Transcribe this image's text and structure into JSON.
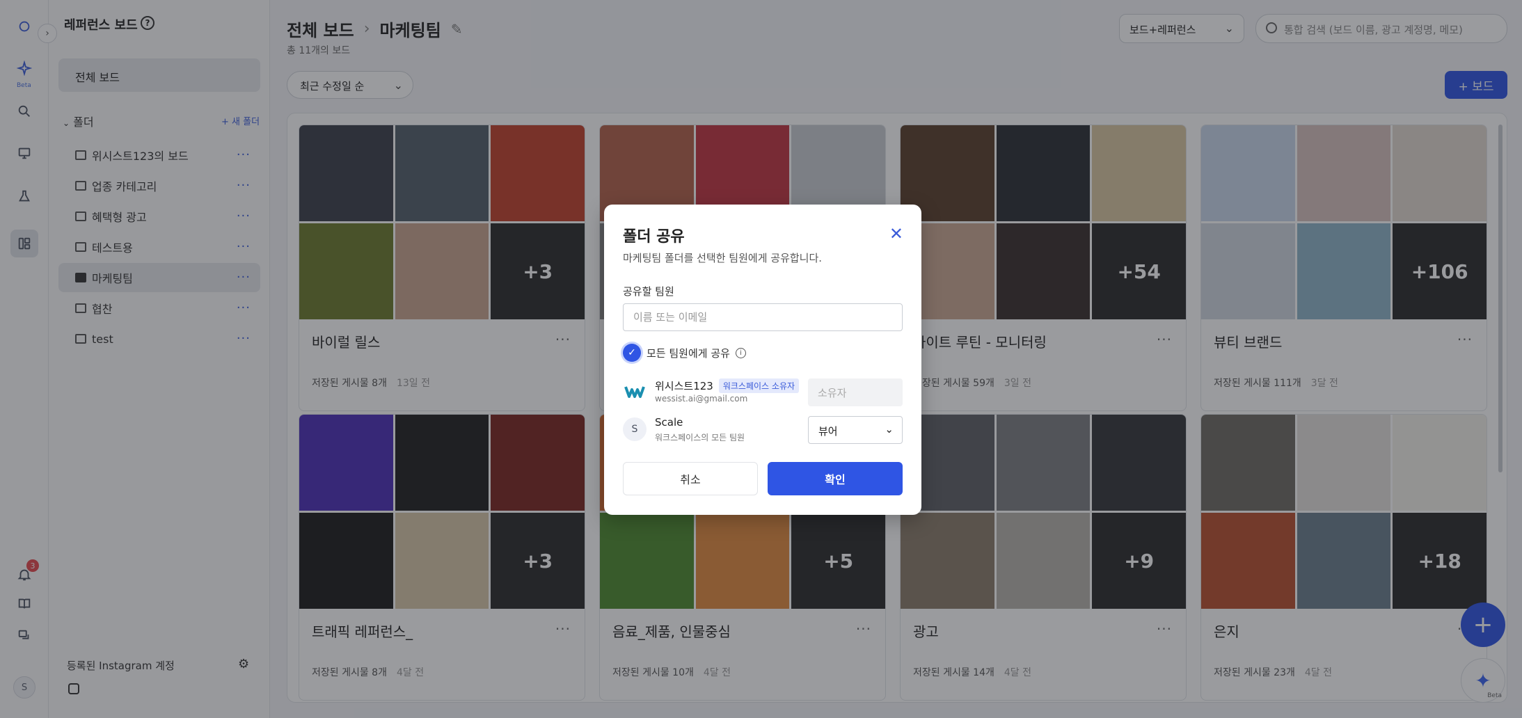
{
  "rail": {
    "beta_label": "Beta",
    "notification_count": "3",
    "avatar_letter": "S"
  },
  "sidebar": {
    "title": "레퍼런스 보드",
    "help_glyph": "?",
    "all_boards": "전체 보드",
    "folder_heading": "폴더",
    "new_folder": "+ 새 폴더",
    "folders": [
      {
        "label": "위시스트123의 보드"
      },
      {
        "label": "업종 카테고리"
      },
      {
        "label": "혜택형 광고"
      },
      {
        "label": "테스트용"
      },
      {
        "label": "마케팅팀"
      },
      {
        "label": "협찬"
      },
      {
        "label": "test"
      }
    ],
    "instagram_title": "등록된 Instagram 계정"
  },
  "header": {
    "crumb_root": "전체 보드",
    "crumb_current": "마케팅팀",
    "count": "총 11개의 보드",
    "filter_value": "보드+레퍼런스",
    "search_placeholder": "통합 검색 (보드 이름, 광고 계정명, 메모)",
    "sort_value": "최근 수정일 순",
    "add_board": "+ 보드"
  },
  "boards": [
    {
      "title": "바이럴 릴스",
      "saved": "저장된 게시물 8개",
      "ago": "13일 전",
      "more": "+3",
      "colors": [
        "#3b3f4a",
        "#52606b",
        "#c2412a",
        "#6c7a2d",
        "#c9a58e",
        "#2a2a2a"
      ]
    },
    {
      "title": "",
      "saved": "",
      "ago": "",
      "more": "",
      "colors": [
        "#b2614a",
        "#c23440",
        "#c8ccd2",
        "#888888",
        "#9aa0a8",
        "#c6c9ce"
      ]
    },
    {
      "title": "사이트 루틴 - 모니터링",
      "saved": "저장된 게시물 59개",
      "ago": "3일 전",
      "more": "+54",
      "colors": [
        "#5a3f2a",
        "#2b2e33",
        "#d9c7a0",
        "#caa892",
        "#3a2f2c",
        "#2a2a2a"
      ]
    },
    {
      "title": "뷰티 브랜드",
      "saved": "저장된 게시물 111개",
      "ago": "3달 전",
      "more": "+106",
      "colors": [
        "#c9d8ec",
        "#d8c2bd",
        "#e2d9cf",
        "#cfd8e0",
        "#8fb4c9",
        "#2a2a2a"
      ]
    },
    {
      "title": "트래픽 레퍼런스_",
      "saved": "저장된 게시물 8개",
      "ago": "4달 전",
      "more": "+3",
      "colors": [
        "#4b2fb8",
        "#202020",
        "#7a2620",
        "#1c1c1c",
        "#d7c6a8",
        "#2a2a2a"
      ]
    },
    {
      "title": "음료_제품, 인물중심",
      "saved": "저장된 게시물 10개",
      "ago": "4달 전",
      "more": "+5",
      "colors": [
        "#d86a2f",
        "#c2412a",
        "#c8ccd2",
        "#4d8a2e",
        "#e28a3f",
        "#2a2a2a"
      ]
    },
    {
      "title": "광고",
      "saved": "저장된 게시물 14개",
      "ago": "4달 전",
      "more": "+9",
      "colors": [
        "#5d6064",
        "#7d7f82",
        "#34363a",
        "#8a7c6a",
        "#b7b2ac",
        "#2a2a2a"
      ]
    },
    {
      "title": "은지",
      "saved": "저장된 게시물 23개",
      "ago": "4달 전",
      "more": "+18",
      "colors": [
        "#6d6a63",
        "#e3e1dc",
        "#f2f0ea",
        "#b94f2e",
        "#6a7f8c",
        "#2a2a2a"
      ]
    }
  ],
  "modal": {
    "title": "폴더 공유",
    "description": "마케팅팀 폴더를 선택한 팀원에게 공유합니다.",
    "member_label": "공유할 팀원",
    "input_placeholder": "이름 또는 이메일",
    "share_all_label": "모든 팀원에게 공유",
    "members": [
      {
        "name": "위시스트123",
        "badge": "워크스페이스 소유자",
        "sub": "wessist.ai@gmail.com",
        "role": "소유자"
      },
      {
        "name": "Scale",
        "initial": "S",
        "sub": "워크스페이스의 모든 팀원",
        "role": "뷰어"
      }
    ],
    "cancel": "취소",
    "confirm": "확인"
  },
  "colors": {
    "accent": "#2f55e4",
    "owner_badge_bg": "#e4e9fc"
  }
}
